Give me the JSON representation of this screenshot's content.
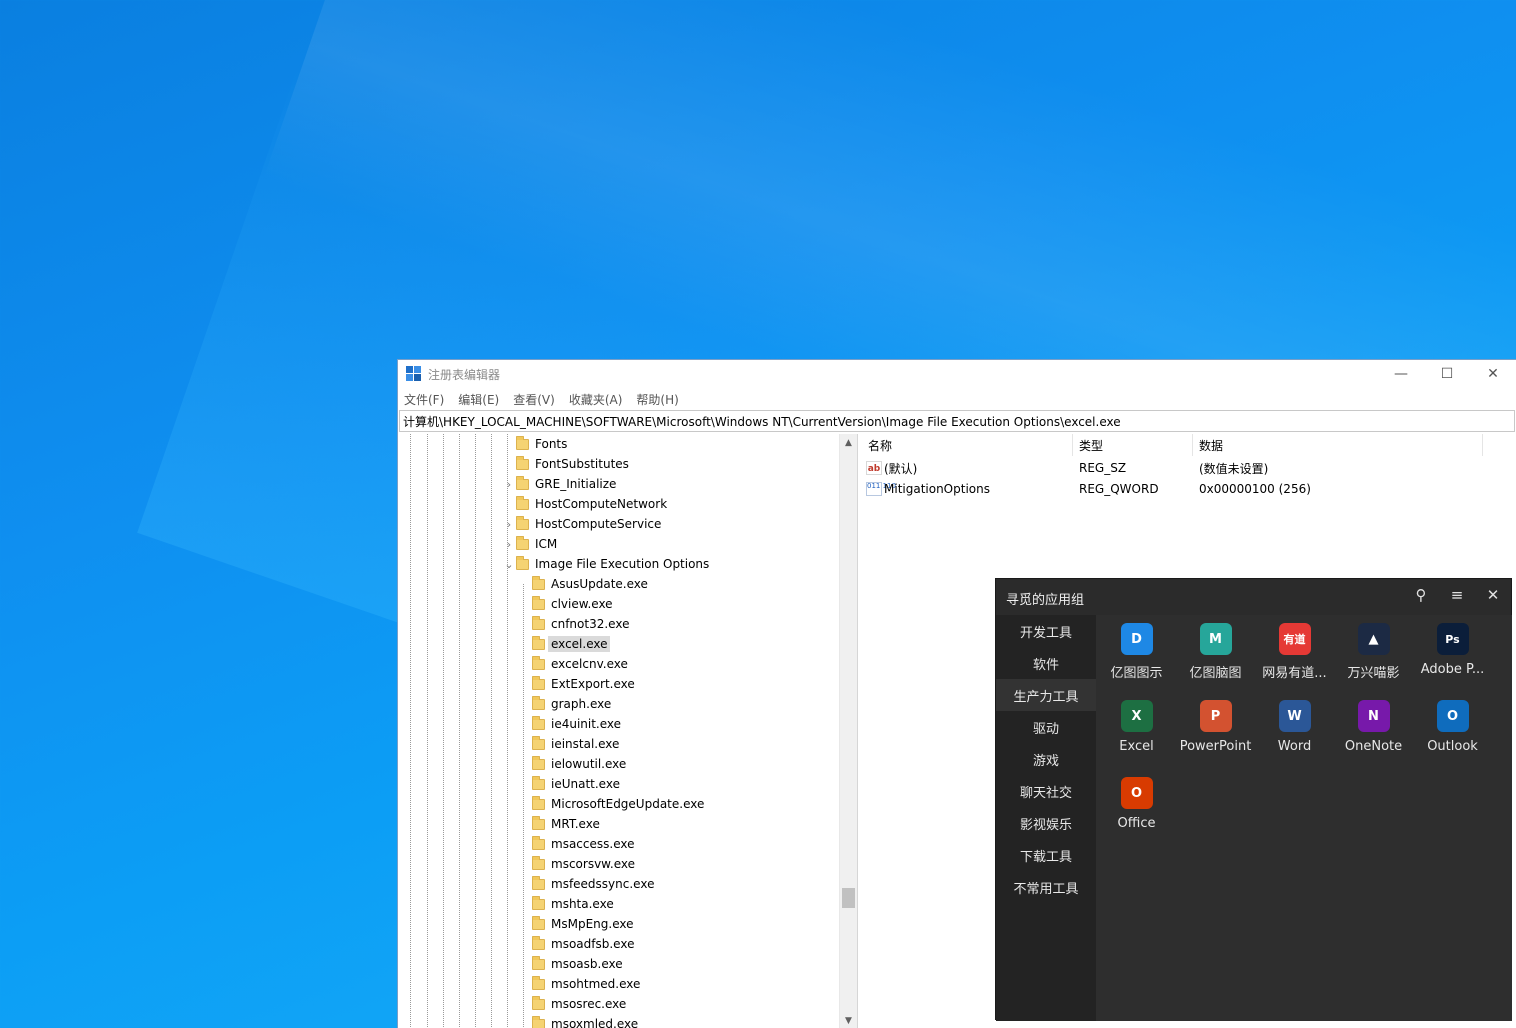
{
  "regedit": {
    "title": "注册表编辑器",
    "controls": {
      "minimize": "—",
      "maximize": "☐",
      "close": "✕"
    },
    "menu": [
      "文件(F)",
      "编辑(E)",
      "查看(V)",
      "收藏夹(A)",
      "帮助(H)"
    ],
    "address": "计算机\\HKEY_LOCAL_MACHINE\\SOFTWARE\\Microsoft\\Windows NT\\CurrentVersion\\Image File Execution Options\\excel.exe",
    "tree": [
      {
        "label": "Fonts",
        "expander": ""
      },
      {
        "label": "FontSubstitutes",
        "expander": ""
      },
      {
        "label": "GRE_Initialize",
        "expander": "›"
      },
      {
        "label": "HostComputeNetwork",
        "expander": ""
      },
      {
        "label": "HostComputeService",
        "expander": "›"
      },
      {
        "label": "ICM",
        "expander": "›"
      },
      {
        "label": "Image File Execution Options",
        "expander": "⌄"
      }
    ],
    "subtree": [
      "AsusUpdate.exe",
      "clview.exe",
      "cnfnot32.exe",
      "excel.exe",
      "excelcnv.exe",
      "ExtExport.exe",
      "graph.exe",
      "ie4uinit.exe",
      "ieinstal.exe",
      "ielowutil.exe",
      "ieUnatt.exe",
      "MicrosoftEdgeUpdate.exe",
      "MRT.exe",
      "msaccess.exe",
      "mscorsvw.exe",
      "msfeedssync.exe",
      "mshta.exe",
      "MsMpEng.exe",
      "msoadfsb.exe",
      "msoasb.exe",
      "msohtmed.exe",
      "msosrec.exe",
      "msoxmled.exe"
    ],
    "selected": "excel.exe",
    "scroll": {
      "up": "▲",
      "down": "▼"
    },
    "columns": {
      "name": "名称",
      "type": "类型",
      "data": "数据"
    },
    "values": [
      {
        "icon": "ab",
        "name": "(默认)",
        "type": "REG_SZ",
        "data": "(数值未设置)"
      },
      {
        "icon": "011 110",
        "name": "MitigationOptions",
        "type": "REG_QWORD",
        "data": "0x00000100 (256)"
      }
    ]
  },
  "appgroup": {
    "title": "寻觅的应用组",
    "icons": {
      "search": "⚲",
      "menu": "≡",
      "close": "✕"
    },
    "categories": [
      "开发工具",
      "软件",
      "生产力工具",
      "驱动",
      "游戏",
      "聊天社交",
      "影视娱乐",
      "下载工具",
      "不常用工具"
    ],
    "active_category": "生产力工具",
    "apps": [
      {
        "label": "亿图图示",
        "glyph": "D",
        "color": "#1e88e5"
      },
      {
        "label": "亿图脑图",
        "glyph": "M",
        "color": "#26a69a"
      },
      {
        "label": "网易有道...",
        "glyph": "有道",
        "color": "#e53935"
      },
      {
        "label": "万兴喵影",
        "glyph": "▲",
        "color": "#1c2a44"
      },
      {
        "label": "Adobe P...",
        "glyph": "Ps",
        "color": "#0b1e3a"
      },
      {
        "label": "Excel",
        "glyph": "X",
        "color": "#1d6f42"
      },
      {
        "label": "PowerPoint",
        "glyph": "P",
        "color": "#d35230"
      },
      {
        "label": "Word",
        "glyph": "W",
        "color": "#2b5797"
      },
      {
        "label": "OneNote",
        "glyph": "N",
        "color": "#7719aa"
      },
      {
        "label": "Outlook",
        "glyph": "O",
        "color": "#0f6cbd"
      },
      {
        "label": "Office",
        "glyph": "O",
        "color": "#d83b01"
      }
    ]
  }
}
